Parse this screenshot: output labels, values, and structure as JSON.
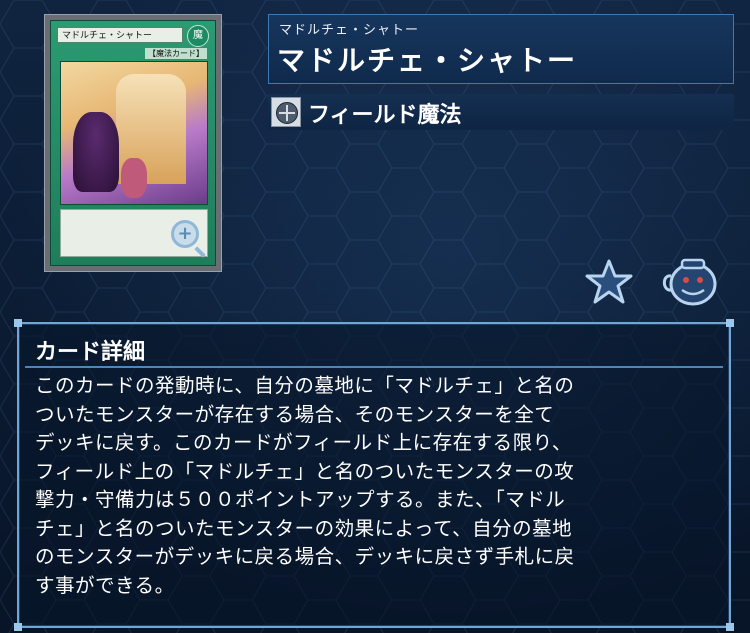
{
  "card": {
    "ruby": "マドルチェ・シャトー",
    "name": "マドルチェ・シャトー",
    "type_label": "フィールド魔法",
    "image": {
      "name_strip": "マドルチェ・シャトー",
      "attribute": "魔",
      "type_line": "【魔法カード】"
    }
  },
  "details": {
    "heading": "カード詳細",
    "text": "このカードの発動時に、自分の墓地に「マドルチェ」と名の\nついたモンスターが存在する場合、そのモンスターを全て\nデッキに戻す。このカードがフィールド上に存在する限り、\nフィールド上の「マドルチェ」と名のついたモンスターの攻\n撃力・守備力は５００ポイントアップする。また、「マドル\nチェ」と名のついたモンスターの効果によって、自分の墓地\nのモンスターがデッキに戻る場合、デッキに戻さず手札に戻\nす事ができる。"
  },
  "icons": {
    "zoom": "zoom-in-icon",
    "type": "field-spell-icon",
    "favorite": "star-icon",
    "deck": "pot-of-greed-icon"
  }
}
